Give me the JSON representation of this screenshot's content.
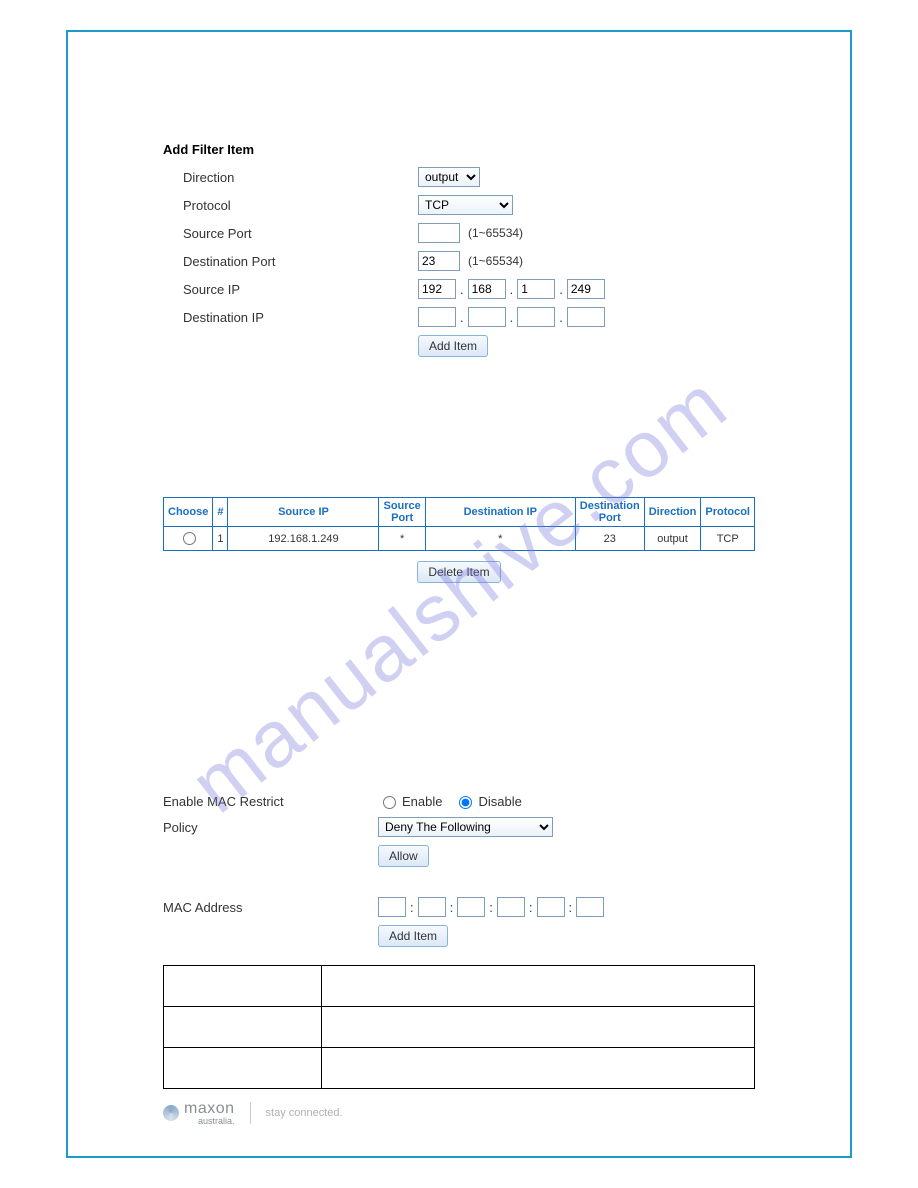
{
  "filter_form": {
    "title": "Add Filter Item",
    "labels": {
      "direction": "Direction",
      "protocol": "Protocol",
      "source_port": "Source Port",
      "dest_port": "Destination Port",
      "source_ip": "Source IP",
      "dest_ip": "Destination IP"
    },
    "direction_value": "output",
    "protocol_value": "TCP",
    "source_port_value": "",
    "dest_port_value": "23",
    "port_hint": "(1~65534)",
    "source_ip": [
      "192",
      "168",
      "1",
      "249"
    ],
    "dest_ip": [
      "",
      "",
      "",
      ""
    ],
    "add_button": "Add Item"
  },
  "filter_table": {
    "headers": [
      "Choose",
      "#",
      "Source IP",
      "Source Port",
      "Destination IP",
      "Destination Port",
      "Direction",
      "Protocol"
    ],
    "rows": [
      {
        "num": "1",
        "src_ip": "192.168.1.249",
        "src_port": "*",
        "dst_ip": "*",
        "dst_port": "23",
        "direction": "output",
        "protocol": "TCP"
      }
    ],
    "delete_button": "Delete Item"
  },
  "mac": {
    "enable_label": "Enable MAC Restrict",
    "policy_label": "Policy",
    "mac_label": "MAC Address",
    "enable_option": "Enable",
    "disable_option": "Disable",
    "policy_value": "Deny The Following",
    "allow_button": "Allow",
    "add_button": "Add Item",
    "address": [
      "",
      "",
      "",
      "",
      "",
      ""
    ]
  },
  "footer": {
    "brand": "maxon",
    "sub": "australia.",
    "tagline": "stay connected."
  },
  "watermark": "manualshive.com"
}
